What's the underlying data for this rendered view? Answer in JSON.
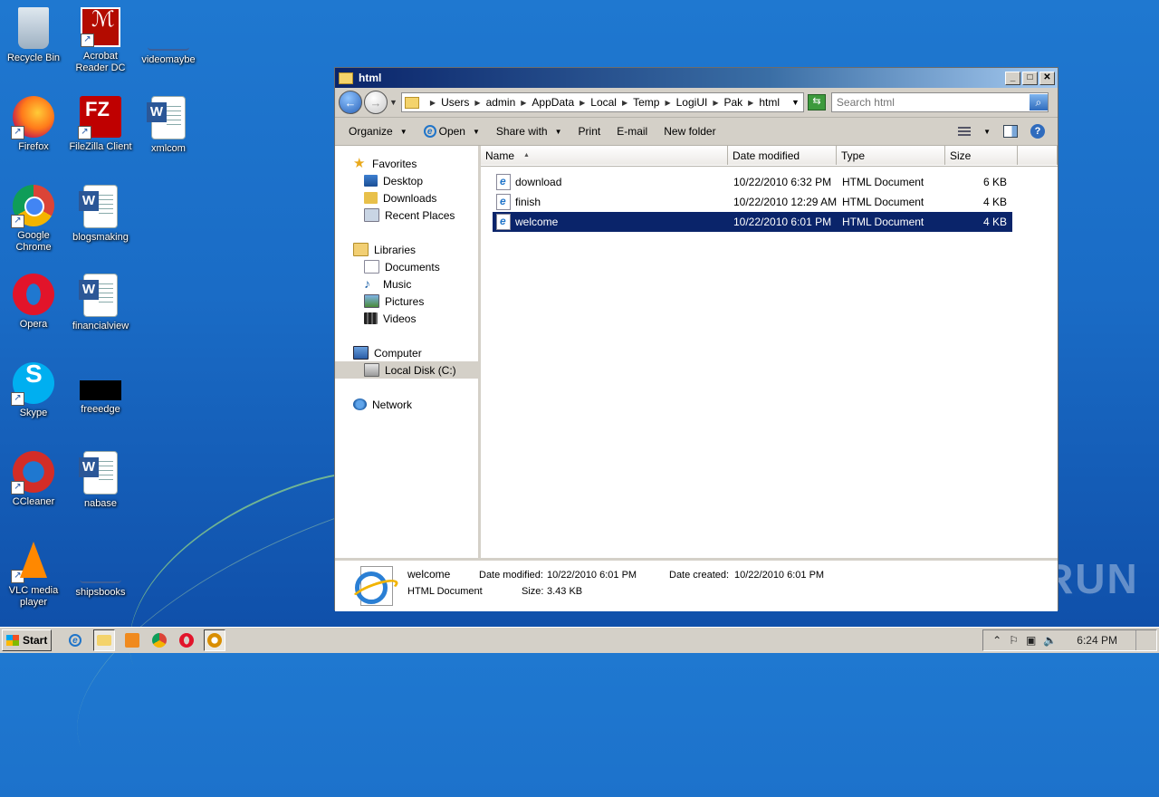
{
  "desktop": {
    "icons": [
      {
        "label": "Recycle Bin",
        "icon": "recycle-bin-icon"
      },
      {
        "label": "Acrobat Reader DC",
        "icon": "acrobat-icon"
      },
      {
        "label": "videomaybe",
        "icon": "blank-file-icon"
      },
      {
        "label": "Firefox",
        "icon": "firefox-icon"
      },
      {
        "label": "FileZilla Client",
        "icon": "filezilla-icon"
      },
      {
        "label": "xmlcom",
        "icon": "word-doc-icon"
      },
      {
        "label": "Google Chrome",
        "icon": "chrome-icon"
      },
      {
        "label": "blogsmaking",
        "icon": "word-doc-icon"
      },
      {
        "label": "Opera",
        "icon": "opera-icon"
      },
      {
        "label": "financialview",
        "icon": "word-doc-icon"
      },
      {
        "label": "Skype",
        "icon": "skype-icon"
      },
      {
        "label": "freeedge",
        "icon": "black-file-icon"
      },
      {
        "label": "CCleaner",
        "icon": "ccleaner-icon"
      },
      {
        "label": "nabase",
        "icon": "word-doc-icon"
      },
      {
        "label": "VLC media player",
        "icon": "vlc-icon"
      },
      {
        "label": "shipsbooks",
        "icon": "blank-file-icon"
      }
    ],
    "watermark": "ANY RUN"
  },
  "window": {
    "title": "html",
    "controls": {
      "minimize": "_",
      "maximize": "□",
      "close": "✕"
    },
    "breadcrumb": [
      "Users",
      "admin",
      "AppData",
      "Local",
      "Temp",
      "LogiUI",
      "Pak",
      "html"
    ],
    "search_placeholder": "Search html",
    "toolbar": {
      "organize": "Organize",
      "open": "Open",
      "share_with": "Share with",
      "print": "Print",
      "email": "E-mail",
      "new_folder": "New folder"
    },
    "nav": {
      "favorites": "Favorites",
      "desktop": "Desktop",
      "downloads": "Downloads",
      "recent_places": "Recent Places",
      "libraries": "Libraries",
      "documents": "Documents",
      "music": "Music",
      "pictures": "Pictures",
      "videos": "Videos",
      "computer": "Computer",
      "local_disk": "Local Disk (C:)",
      "network": "Network"
    },
    "columns": {
      "name": "Name",
      "date": "Date modified",
      "type": "Type",
      "size": "Size"
    },
    "files": [
      {
        "name": "download",
        "date": "10/22/2010 6:32 PM",
        "type": "HTML Document",
        "size": "6 KB",
        "selected": false
      },
      {
        "name": "finish",
        "date": "10/22/2010 12:29 AM",
        "type": "HTML Document",
        "size": "4 KB",
        "selected": false
      },
      {
        "name": "welcome",
        "date": "10/22/2010 6:01 PM",
        "type": "HTML Document",
        "size": "4 KB",
        "selected": true
      }
    ],
    "details": {
      "name": "welcome",
      "type": "HTML Document",
      "date_modified_label": "Date modified:",
      "date_modified": "10/22/2010 6:01 PM",
      "date_created_label": "Date created:",
      "date_created": "10/22/2010 6:01 PM",
      "size_label": "Size:",
      "size": "3.43 KB"
    }
  },
  "taskbar": {
    "start": "Start",
    "clock": "6:24 PM"
  }
}
